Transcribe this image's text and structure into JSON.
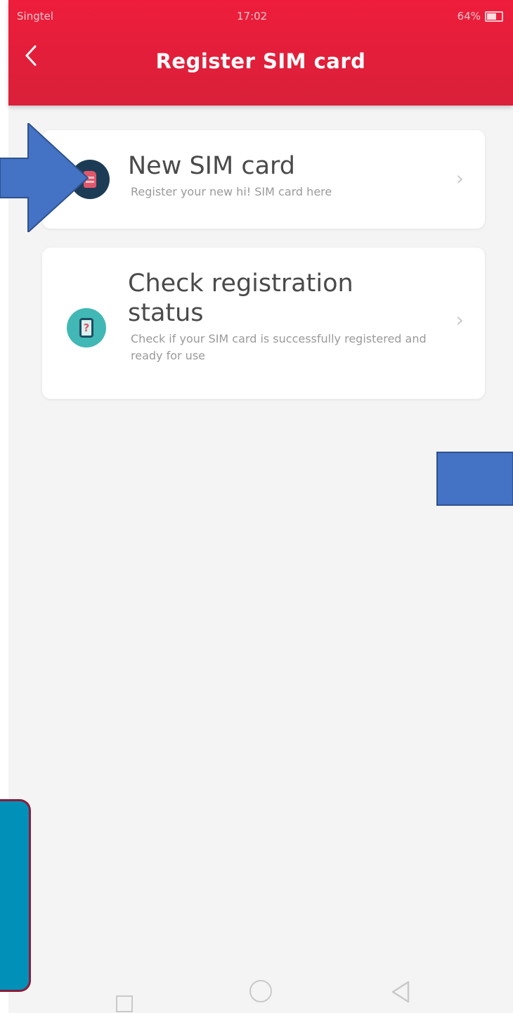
{
  "status_bar": {
    "carrier": "Singtel",
    "time": "17:02",
    "battery": "64%"
  },
  "header": {
    "back_icon": "chevron-left-icon",
    "title": "Register SIM card"
  },
  "options": [
    {
      "icon": "sim-card-icon",
      "title": "New SIM card",
      "subtitle": "Register your new hi! SIM card here"
    },
    {
      "icon": "phone-question-icon",
      "title": "Check registration status",
      "subtitle": "Check if your SIM card is successfully registered and ready for use"
    }
  ],
  "nav": {
    "recent_icon": "square-icon",
    "home_icon": "circle-icon",
    "back_icon": "triangle-back-icon"
  },
  "colors": {
    "header": "#ee1d3b",
    "annotation_blue": "#4472c4",
    "annotation_teal": "#0090b8",
    "annotation_border": "#8c1c3a"
  }
}
